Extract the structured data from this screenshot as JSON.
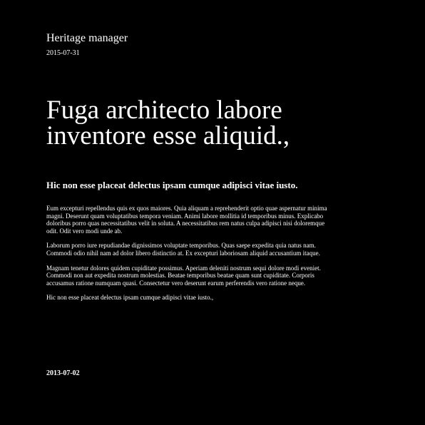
{
  "header": {
    "title": "Heritage manager",
    "date": "2015-07-31"
  },
  "article": {
    "headline": "Fuga architecto labore inventore esse aliquid.,",
    "subheadline": "Hic non esse placeat delectus ipsam cumque adipisci vitae iusto.",
    "paragraphs": [
      "Eum excepturi repellendus quis ex quos maiores. Quia aliquam a reprehenderit optio quae aspernatur minima magni. Deserunt quam voluptatibus tempora veniam. Animi labore mollitia id temporibus minus. Explicabo doloribus porro quas necessitatibus velit in soluta. A necessitatibus rem natus culpa adipisci nisi doloremque odit. Odit vero modi unde ab.",
      "Laborum porro iure repudiandae dignissimos voluptate temporibus. Quas saepe expedita quia natus nam. Commodi odio nihil nam ad dolor libero distinctio at. Ex excepturi laboriosam aliquid accusantium itaque.",
      "Magnam tenetur dolores quidem cupiditate possimus. Aperiam deleniti nostrum sequi dolore modi eveniet. Commodi non aut expedita nostrum molestias. Beatae temporibus beatae quam sunt cupiditate. Corporis accusamus ratione numquam quasi. Consectetur vero deserunt earum perferendis vero ratione neque.",
      "Hic non esse placeat delectus ipsam cumque adipisci vitae iusto.,"
    ]
  },
  "footer": {
    "date": "2013-07-02"
  },
  "colors": {
    "background": "#000000",
    "text": "#ffffff"
  }
}
